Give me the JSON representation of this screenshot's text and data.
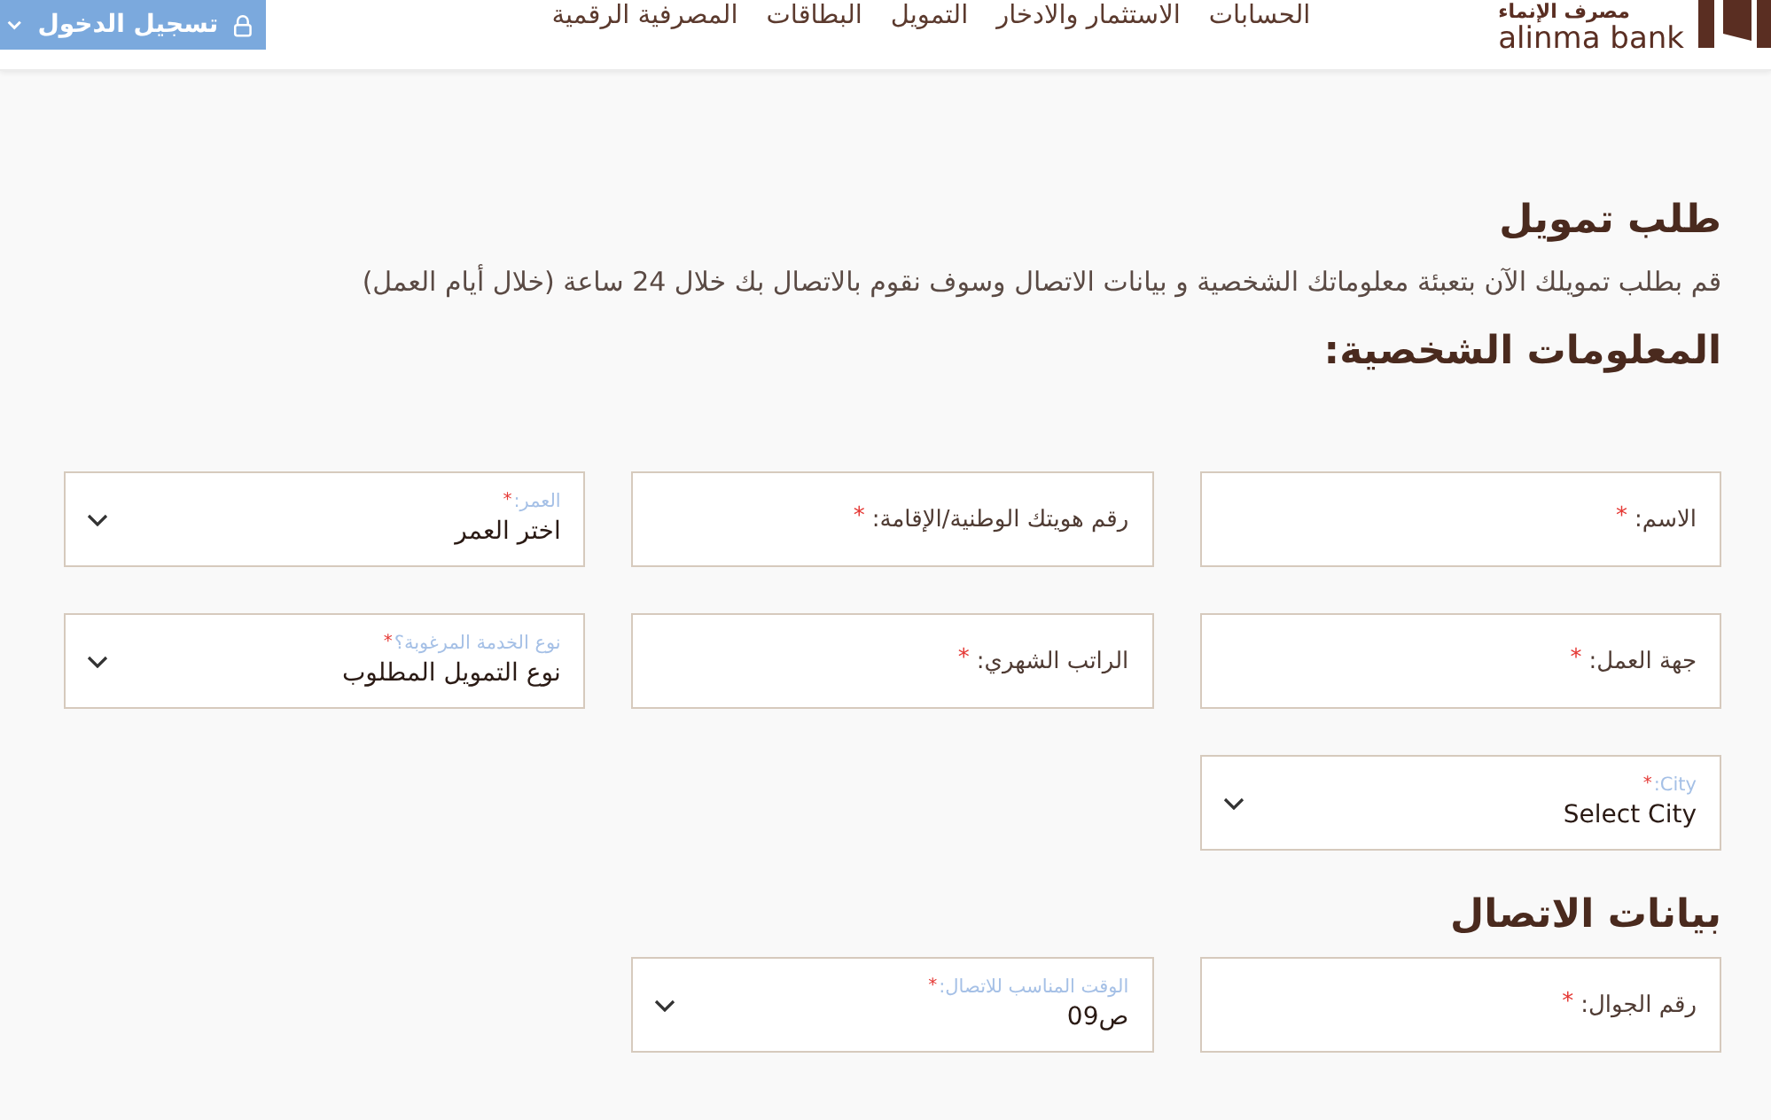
{
  "header": {
    "logo": {
      "arabic": "مصرف الإنماء",
      "latin": "alinma bank"
    },
    "nav": [
      {
        "label": "الحسابات"
      },
      {
        "label": "الاستثمار والادخار"
      },
      {
        "label": "التمويل"
      },
      {
        "label": "البطاقات"
      },
      {
        "label": "المصرفية الرقمية"
      }
    ],
    "login_button": {
      "label": "تسجيل الدخول"
    }
  },
  "request": {
    "title": "طلب تمويل",
    "intro": "قم بطلب تمويلك الآن بتعبئة معلوماتك الشخصية و بيانات الاتصال وسوف نقوم بالاتصال بك خلال 24 ساعة (خلال أيام العمل)"
  },
  "personal_info": {
    "heading": "المعلومات الشخصية:",
    "fields": [
      {
        "kind": "text",
        "label": "الاسم:",
        "asterisk": "*"
      },
      {
        "kind": "text",
        "label": "رقم هويتك الوطنية/الإقامة:",
        "asterisk": "*"
      },
      {
        "kind": "select",
        "label": "العمر:",
        "asterisk": "*",
        "value": "اختر العمر"
      },
      {
        "kind": "text",
        "label": "جهة العمل:",
        "asterisk": "*"
      },
      {
        "kind": "text",
        "label": "الراتب الشهري:",
        "asterisk": "*"
      },
      {
        "kind": "select",
        "label": "نوع الخدمة المرغوبة؟",
        "asterisk": "*",
        "value": "نوع التمويل المطلوب"
      },
      {
        "kind": "select",
        "label": "City:",
        "asterisk": "*",
        "value": "Select City"
      }
    ]
  },
  "contact_info": {
    "heading": "بيانات الاتصال",
    "fields": [
      {
        "kind": "text",
        "label": "رقم الجوال:",
        "asterisk": "*"
      },
      {
        "kind": "select",
        "label": "الوقت المناسب للاتصال:",
        "asterisk": "*",
        "value": "09ص"
      }
    ]
  }
}
